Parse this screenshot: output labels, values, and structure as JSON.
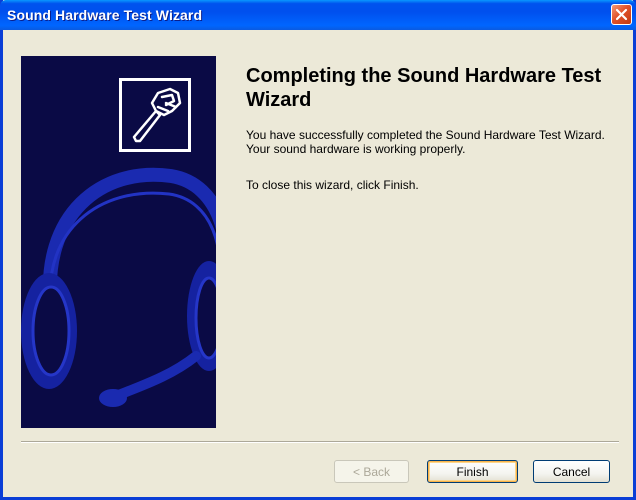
{
  "window": {
    "title": "Sound Hardware Test Wizard"
  },
  "icons": {
    "close": "close-icon",
    "wrench": "wrench-icon",
    "headset": "headset-icon"
  },
  "content": {
    "heading": "Completing the Sound Hardware Test Wizard",
    "paragraph1": "You have successfully completed the Sound Hardware Test Wizard. Your sound hardware is working properly.",
    "paragraph2": "To close this wizard, click Finish."
  },
  "buttons": {
    "back": "< Back",
    "finish": "Finish",
    "cancel": "Cancel"
  },
  "colors": {
    "titlebar": "#0053EE",
    "left_panel": "#0A0A45",
    "dialog_bg": "#ECE9D8",
    "close_button": "#E0522A"
  }
}
